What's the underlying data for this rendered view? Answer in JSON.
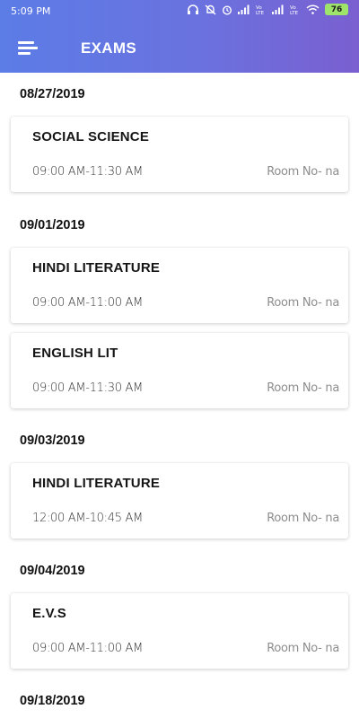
{
  "status_bar": {
    "time": "5:09 PM",
    "battery": "76"
  },
  "header": {
    "title": "EXAMS"
  },
  "groups": [
    {
      "date": "08/27/2019",
      "exams": [
        {
          "subject": "SOCIAL SCIENCE",
          "time": "09:00 AM-11:30 AM",
          "room": "Room No- na"
        }
      ]
    },
    {
      "date": "09/01/2019",
      "exams": [
        {
          "subject": "HINDI LITERATURE",
          "time": "09:00 AM-11:00 AM",
          "room": "Room No- na"
        },
        {
          "subject": "ENGLISH LIT",
          "time": "09:00 AM-11:30 AM",
          "room": "Room No- na"
        }
      ]
    },
    {
      "date": "09/03/2019",
      "exams": [
        {
          "subject": "HINDI LITERATURE",
          "time": "12:00 AM-10:45 AM",
          "room": "Room No- na"
        }
      ]
    },
    {
      "date": "09/04/2019",
      "exams": [
        {
          "subject": "E.V.S",
          "time": "09:00 AM-11:00 AM",
          "room": "Room No- na"
        }
      ]
    },
    {
      "date": "09/18/2019",
      "exams": []
    }
  ]
}
